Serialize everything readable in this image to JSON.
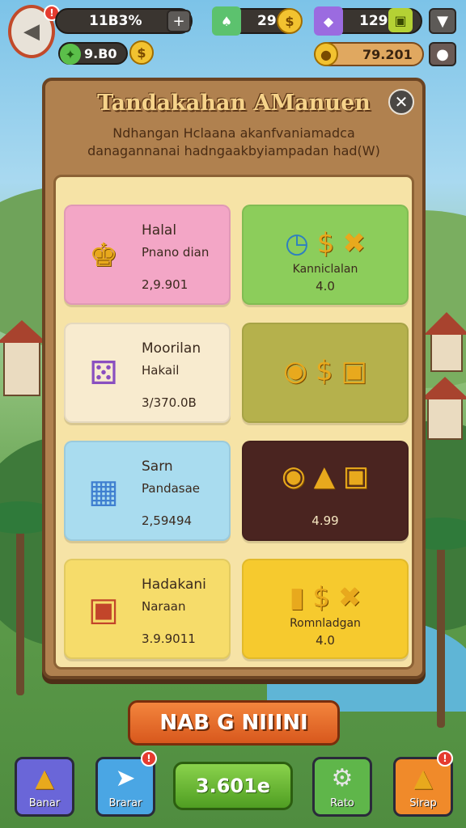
{
  "hud": {
    "level_value": "11B3%",
    "gems_value": "9.B0",
    "cards_value": "29",
    "energy_value": "129",
    "coins_value": "79.201"
  },
  "panel": {
    "title": "Tandakahan AManuen",
    "desc_line1": "Ndhangan Hclaana akanfvaniamadca",
    "desc_line2": "danagannanai hadngaakbyiampadan had(W)"
  },
  "cards": [
    {
      "title": "Halal",
      "sub": "Pnano dian",
      "price": "2,9.901",
      "bg": "#f3a6c6"
    },
    {
      "reward_label": "Kanniclalan",
      "reward_val": "4.0",
      "bg": "#8ccd5b"
    },
    {
      "title": "Moorilan",
      "sub": "Hakail",
      "price": "3/370.0B",
      "bg": "#f8ebcf"
    },
    {
      "bg": "#b5b14c"
    },
    {
      "title": "Sarn",
      "sub": "Pandasae",
      "price": "2,59494",
      "bg": "#a9dcef"
    },
    {
      "reward_val": "4.99",
      "bg": "#4a2420"
    },
    {
      "title": "Hadakani",
      "sub": "Naraan",
      "price": "3.9.9011",
      "bg": "#f6dc6a"
    },
    {
      "reward_label": "Romnladgan",
      "reward_val": "4.0",
      "bg": "#f6ca2e"
    }
  ],
  "big_button": "NAB G NIIINI",
  "nav": {
    "left1": "Banar",
    "left2": "Brarar",
    "center": "3.601e",
    "right1": "Rato",
    "right2": "Sirap"
  },
  "colors": {
    "accent": "#e8a91d",
    "panel_wood": "#b0814f",
    "inner_bg": "#f6e3a6",
    "big_button": "#e56a28"
  }
}
